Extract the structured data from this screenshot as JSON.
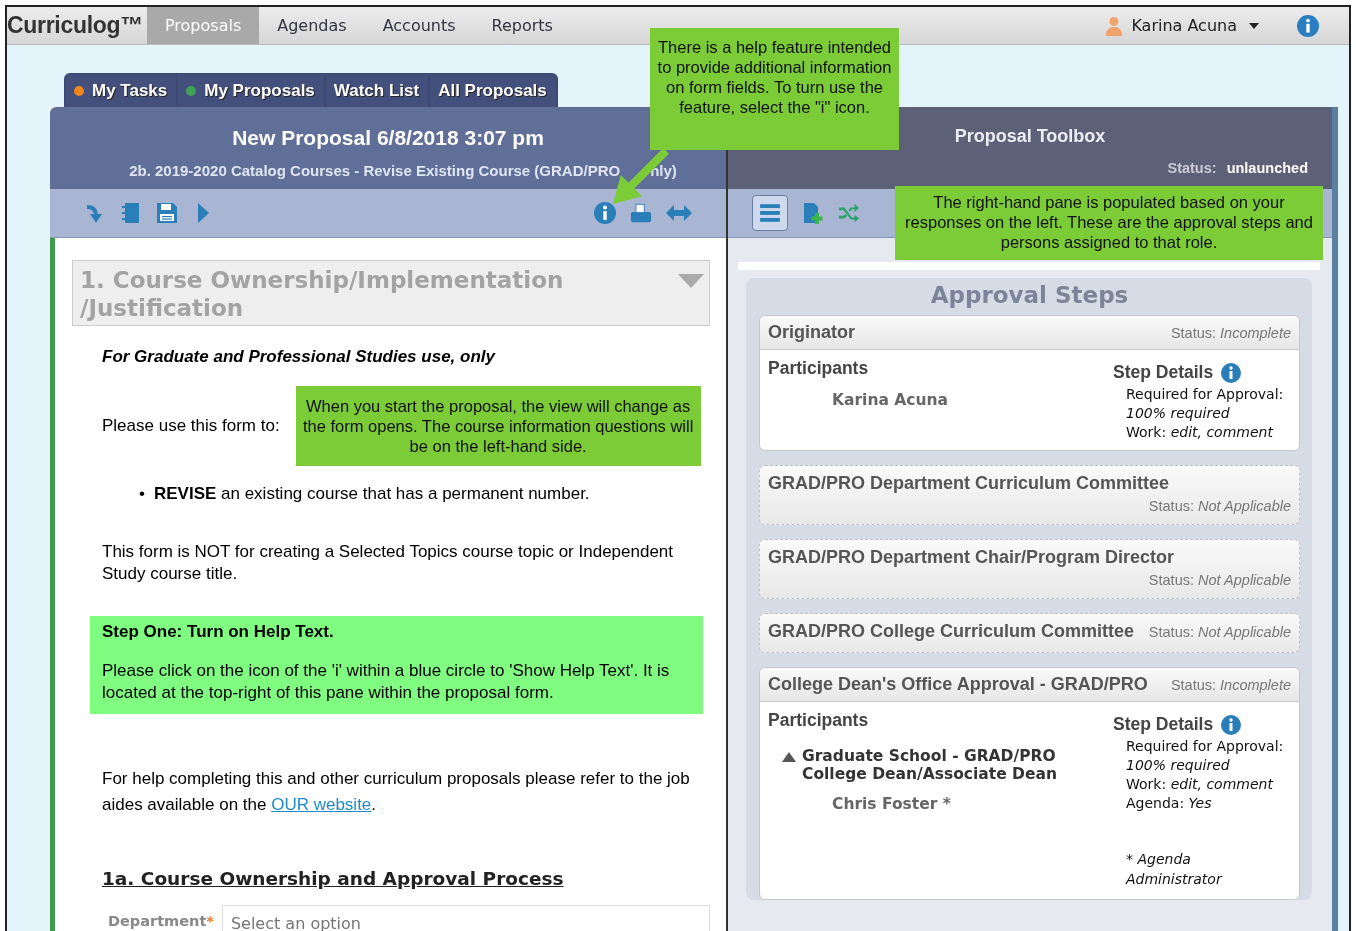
{
  "app": {
    "logo": "Curriculog™"
  },
  "nav_tabs": [
    {
      "label": "Proposals",
      "selected": true
    },
    {
      "label": "Agendas",
      "selected": false
    },
    {
      "label": "Accounts",
      "selected": false
    },
    {
      "label": "Reports",
      "selected": false
    }
  ],
  "user": {
    "name": "Karina Acuna"
  },
  "proposal_tabs": [
    {
      "label": "My Tasks",
      "color": "#f0861a"
    },
    {
      "label": "My Proposals",
      "color": "#3fa05a"
    },
    {
      "label": "Watch List"
    },
    {
      "label": "All Proposals"
    }
  ],
  "proposal": {
    "title": "New Proposal 6/8/2018 3:07 pm",
    "subtitle": "2b. 2019-2020 Catalog Courses - Revise Existing Course (GRAD/PRO",
    "subtitle_tail": "nly)"
  },
  "form": {
    "section_title": "1. Course Ownership/Implementation /Justification",
    "section_expanded": true,
    "note": "For Graduate and Professional Studies use, only",
    "use_label": "Please use this form to:",
    "bullets": [
      {
        "marker": "•",
        "text": "**REVISE** an existing course that has a permanent number."
      }
    ],
    "not_for": "This form is NOT for creating a Selected Topics course topic or Independent Study course title.",
    "step_title": "Step One: Turn on Help Text.",
    "step_text": "Please click on the icon of the 'i' within a blue circle to 'Show Help Text'. It is located at the top-right of this pane within the proposal form.",
    "help_before": "For help completing this and other curriculum proposals please refer to the job aides available on the ",
    "help_link": "OUR website",
    "help_after": ".",
    "subsection_title": "1a. Course Ownership and Approval Process",
    "field": {
      "label": "Department",
      "required": true,
      "required_mark": "*",
      "placeholder": "Select an option"
    }
  },
  "toolbox": {
    "title": "Proposal Toolbox",
    "status_label": "Status:",
    "status": "unlaunched"
  },
  "approval_steps": {
    "title": "Approval Steps",
    "steps": [
      {
        "name": "Originator",
        "status_label": "Status:",
        "status": "Incomplete",
        "expanded": true,
        "participants_label": "Participants",
        "details_label": "Step Details",
        "participants": [
          {
            "kind": "person",
            "name": "Karina Acuna"
          }
        ],
        "details": [
          {
            "label": "Required for Approval:"
          },
          {
            "value": "100% required"
          },
          {
            "label": "Work:",
            "value": "edit, comment"
          }
        ]
      },
      {
        "name": "GRAD/PRO Department Curriculum Committee",
        "status_label": "Status:",
        "status": "Not Applicable",
        "expanded": false
      },
      {
        "name": "GRAD/PRO Department Chair/Program Director",
        "status_label": "Status:",
        "status": "Not Applicable",
        "expanded": false
      },
      {
        "name": "GRAD/PRO College Curriculum Committee",
        "status_label": "Status:",
        "status": "Not Applicable",
        "expanded": false
      },
      {
        "name": "College Dean's Office Approval - GRAD/PRO",
        "status_label": "Status:",
        "status": "Incomplete",
        "expanded": true,
        "participants_label": "Participants",
        "details_label": "Step Details",
        "participants": [
          {
            "kind": "group",
            "name": "Graduate School - GRAD/PRO College Dean/Associate Dean",
            "children": [
              {
                "kind": "person",
                "name": "Chris Foster *"
              }
            ]
          }
        ],
        "details": [
          {
            "label": "Required for Approval:"
          },
          {
            "value": "100% required"
          },
          {
            "label": "Work:",
            "value": "edit, comment"
          },
          {
            "label": "Agenda:",
            "value": "Yes"
          }
        ],
        "footnote": "* Agenda Administrator"
      }
    ]
  },
  "callouts": [
    {
      "text": "There is a help feature intended to provide additional information on form fields. To turn use the feature, select the \"i\" icon."
    },
    {
      "text": "The right-hand pane is populated based on your responses on the left. These are the approval steps and persons assigned to that role."
    },
    {
      "text": "When you start the proposal, the view will change as the form opens. The course information questions will be on the left-hand side."
    }
  ]
}
